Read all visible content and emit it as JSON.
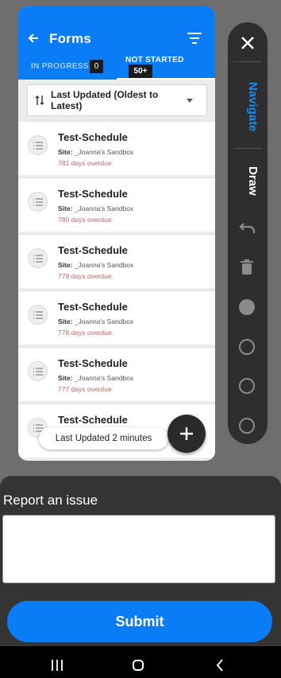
{
  "header": {
    "title": "Forms"
  },
  "tabs": [
    {
      "label": "IN PROGRESS",
      "count": "0"
    },
    {
      "label": "NOT STARTED",
      "count": "50+"
    }
  ],
  "sort": {
    "label": "Last Updated (Oldest to Latest)"
  },
  "forms": [
    {
      "title": "Test-Schedule",
      "site_label": "Site:",
      "site": "_Joanna's Sandbox",
      "overdue": "781 days overdue"
    },
    {
      "title": "Test-Schedule",
      "site_label": "Site:",
      "site": "_Joanna's Sandbox",
      "overdue": "780 days overdue"
    },
    {
      "title": "Test-Schedule",
      "site_label": "Site:",
      "site": "_Joanna's Sandbox",
      "overdue": "779 days overdue"
    },
    {
      "title": "Test-Schedule",
      "site_label": "Site:",
      "site": "_Joanna's Sandbox",
      "overdue": "778 days overdue"
    },
    {
      "title": "Test-Schedule",
      "site_label": "Site:",
      "site": "_Joanna's Sandbox",
      "overdue": "777 days overdue"
    },
    {
      "title": "Test-Schedule"
    }
  ],
  "toast": "Last Updated 2 minutes",
  "toolbar": {
    "navigate": "Navigate",
    "draw": "Draw"
  },
  "report": {
    "label": "Report an issue",
    "value": "",
    "submit": "Submit"
  },
  "colors": {
    "primary": "#0a7cf5",
    "overdue": "#d1646b",
    "toolbar": "#2e2e2e"
  }
}
